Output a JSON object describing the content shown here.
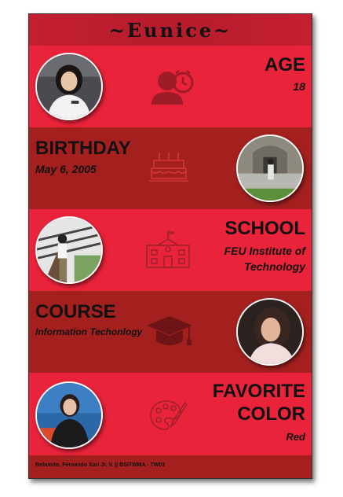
{
  "header": {
    "title": "~Eunice~"
  },
  "sections": [
    {
      "label": "AGE",
      "value": "18",
      "icon": "person-clock-icon"
    },
    {
      "label": "BIRTHDAY",
      "value": "May 6, 2005",
      "icon": "birthday-cake-icon"
    },
    {
      "label": "SCHOOL",
      "value_lines": [
        "FEU Institute of",
        "Technology"
      ],
      "icon": "school-building-icon"
    },
    {
      "label": "COURSE",
      "value": "Information Techonlogy",
      "icon": "graduation-cap-icon"
    },
    {
      "label_lines": [
        "FAVORITE",
        "COLOR"
      ],
      "value": "Red",
      "icon": "paint-palette-icon"
    }
  ],
  "footer": {
    "credit": "Rebonito, Fernando Xari Jr. V. || BSITWMA - TW03"
  },
  "colors": {
    "light": "#e8233a",
    "dark": "#a3201f",
    "icon": "#9e1c27",
    "text": "#111111"
  }
}
